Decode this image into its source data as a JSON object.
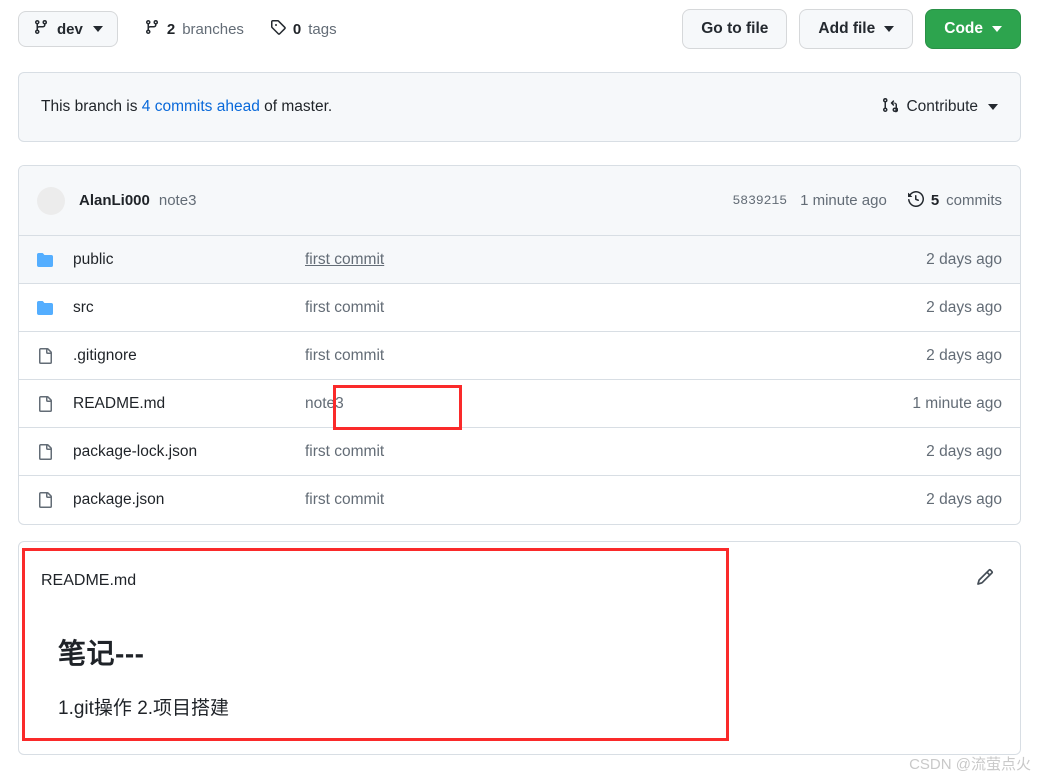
{
  "toolbar": {
    "branch_button": {
      "label": "dev",
      "icon": "git-branch-icon"
    },
    "branches_count": "2",
    "branches_label": "branches",
    "tags_count": "0",
    "tags_label": "tags",
    "go_to_file": "Go to file",
    "add_file": "Add file",
    "code": "Code"
  },
  "banner": {
    "prefix": "This branch is",
    "link": "4 commits ahead",
    "suffix": "of master.",
    "contribute": "Contribute"
  },
  "commit_header": {
    "author": "AlanLi000",
    "message": "note3",
    "sha": "5839215",
    "when": "1 minute ago",
    "commits_count": "5",
    "commits_label": "commits"
  },
  "files": [
    {
      "name": "public",
      "type": "folder",
      "message": "first commit",
      "message_underlined": true,
      "date": "2 days ago",
      "hovered": true
    },
    {
      "name": "src",
      "type": "folder",
      "message": "first commit",
      "message_underlined": false,
      "date": "2 days ago",
      "hovered": false
    },
    {
      "name": ".gitignore",
      "type": "file",
      "message": "first commit",
      "message_underlined": false,
      "date": "2 days ago",
      "hovered": false
    },
    {
      "name": "README.md",
      "type": "file",
      "message": "note3",
      "message_underlined": false,
      "date": "1 minute ago",
      "hovered": false
    },
    {
      "name": "package-lock.json",
      "type": "file",
      "message": "first commit",
      "message_underlined": false,
      "date": "2 days ago",
      "hovered": false
    },
    {
      "name": "package.json",
      "type": "file",
      "message": "first commit",
      "message_underlined": false,
      "date": "2 days ago",
      "hovered": false
    }
  ],
  "readme": {
    "title": "README.md",
    "edit_icon": "pencil-icon",
    "heading": "笔记---",
    "body": "1.git操作 2.项目搭建"
  },
  "annotations": [
    {
      "name": "note3-commit-message",
      "color": "#fa2a2a"
    },
    {
      "name": "readme-preview-section",
      "color": "#fa2a2a"
    }
  ],
  "watermark": "CSDN @流萤点火",
  "colors": {
    "accent_green": "#2da44e",
    "link_blue": "#0969da",
    "folder_blue": "#54aeff",
    "annotation_red": "#fa2a2a",
    "muted_text": "#636c76",
    "surface": "#f6f8fa",
    "border": "#d8dee4"
  }
}
